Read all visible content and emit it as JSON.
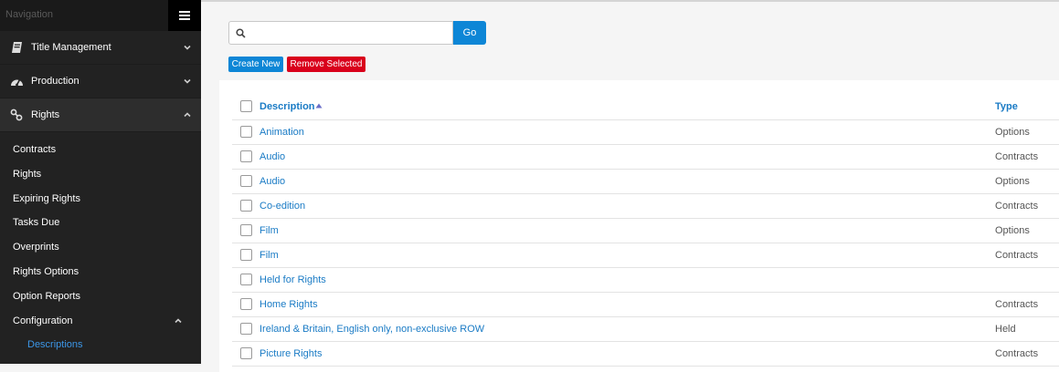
{
  "sidebar": {
    "title": "Navigation",
    "sections": [
      {
        "label": "Title Management",
        "icon": "book-icon"
      },
      {
        "label": "Production",
        "icon": "dashboard-icon"
      },
      {
        "label": "Rights",
        "icon": "link-icon"
      }
    ],
    "rights_items": [
      "Contracts",
      "Rights",
      "Expiring Rights",
      "Tasks Due",
      "Overprints",
      "Rights Options",
      "Option Reports"
    ],
    "configuration_label": "Configuration",
    "configuration_items": [
      "Descriptions"
    ]
  },
  "toolbar": {
    "search_placeholder": "",
    "go_label": "Go",
    "create_label": "Create New",
    "remove_label": "Remove Selected"
  },
  "table": {
    "columns": [
      "Description",
      "Type"
    ],
    "rows": [
      {
        "description": "Animation",
        "type": "Options"
      },
      {
        "description": "Audio",
        "type": "Contracts"
      },
      {
        "description": "Audio",
        "type": "Options"
      },
      {
        "description": "Co-edition",
        "type": "Contracts"
      },
      {
        "description": "Film",
        "type": "Options"
      },
      {
        "description": "Film",
        "type": "Contracts"
      },
      {
        "description": "Held for Rights",
        "type": ""
      },
      {
        "description": "Home Rights",
        "type": "Contracts"
      },
      {
        "description": "Ireland & Britain, English only, non-exclusive ROW",
        "type": "Held"
      },
      {
        "description": "Picture Rights",
        "type": "Contracts"
      }
    ]
  },
  "colors": {
    "accent": "#0d86d6",
    "danger": "#d9001b",
    "link": "#1a7bc5"
  }
}
